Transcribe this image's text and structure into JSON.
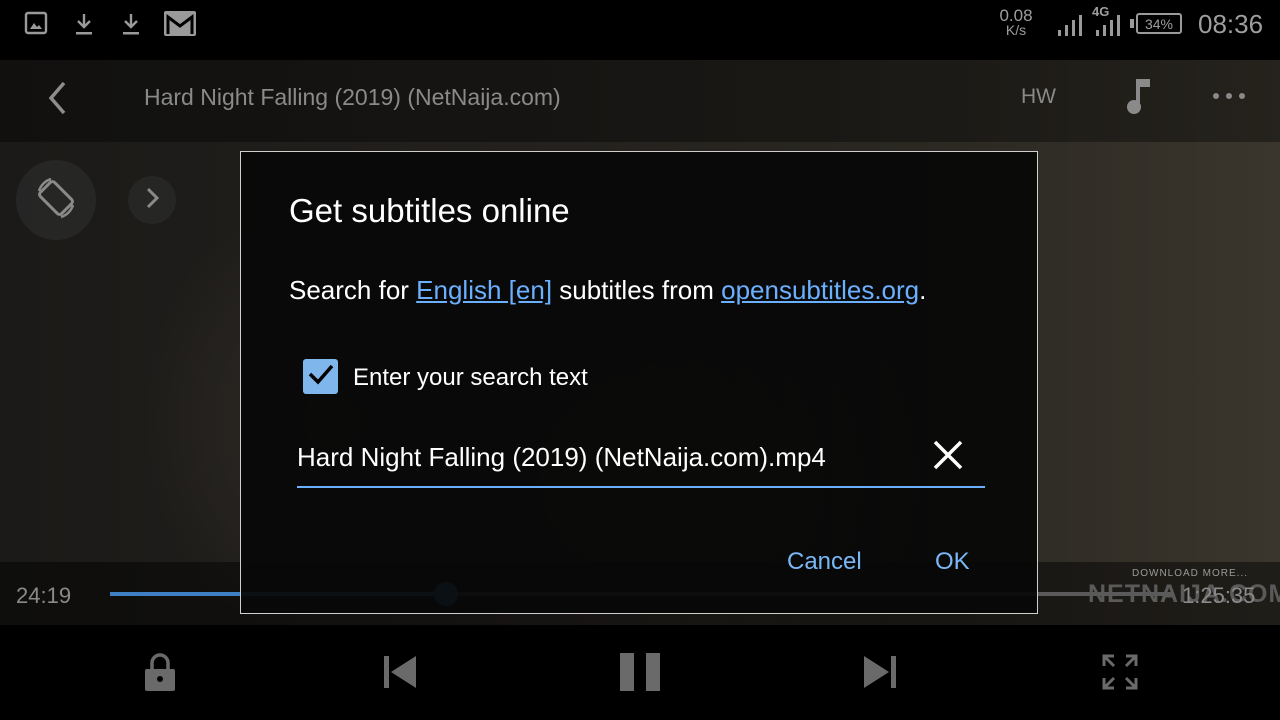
{
  "status_bar": {
    "net_speed_value": "0.08",
    "net_speed_unit": "K/s",
    "network_type": "4G",
    "battery": "34%",
    "time": "08:36"
  },
  "player": {
    "title": "Hard Night Falling (2019) (NetNaija.com)",
    "hw_label": "HW",
    "current_time": "24:19",
    "total_time": "1:25:35",
    "progress": 0.316,
    "watermark_small": "DOWNLOAD MORE...",
    "watermark_large": "NETNAIJA.COM"
  },
  "dialog": {
    "title": "Get subtitles online",
    "desc_prefix": "Search for ",
    "desc_language_link": "English [en]",
    "desc_middle": " subtitles from ",
    "desc_site_link": "opensubtitles.org",
    "desc_suffix": ".",
    "checkbox_label": "Enter your search text",
    "checkbox_checked": true,
    "search_value": "Hard Night Falling (2019) (NetNaija.com).mp4",
    "cancel_label": "Cancel",
    "ok_label": "OK"
  },
  "colors": {
    "accent": "#6ab0ff",
    "checkbox": "#7fb6ec",
    "dialog_bg": "#080808"
  },
  "icons": [
    "gallery-icon",
    "download-icon",
    "download-icon",
    "gmail-icon",
    "signal-icon",
    "battery-icon",
    "back-arrow-icon",
    "music-note-icon",
    "more-dots-icon",
    "screen-rotate-icon",
    "chevron-right-icon",
    "close-icon",
    "lock-icon",
    "skip-previous-icon",
    "pause-icon",
    "skip-next-icon",
    "fullscreen-icon"
  ]
}
